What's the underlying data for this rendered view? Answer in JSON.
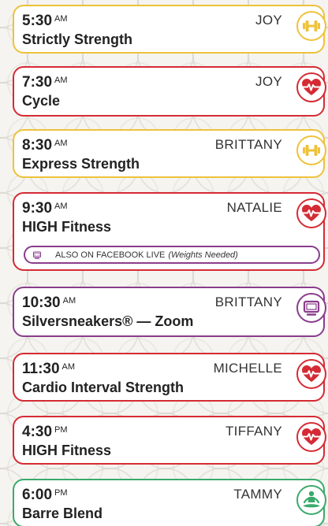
{
  "colors": {
    "strength": "#eec23a",
    "cardio": "#d52b34",
    "virtual": "#8a3d8c",
    "mind_body": "#3aaa6c"
  },
  "classes": [
    {
      "time": "5:30",
      "ampm": "AM",
      "instructor": "JOY",
      "title": "Strictly Strength",
      "icon": "dumbbell-icon",
      "category": "strength"
    },
    {
      "time": "7:30",
      "ampm": "AM",
      "instructor": "JOY",
      "title": "Cycle",
      "icon": "heartbeat-icon",
      "category": "cardio"
    },
    {
      "time": "8:30",
      "ampm": "AM",
      "instructor": "BRITTANY",
      "title": "Express Strength",
      "icon": "dumbbell-icon",
      "category": "strength"
    },
    {
      "time": "9:30",
      "ampm": "AM",
      "instructor": "NATALIE",
      "title": "HIGH Fitness",
      "icon": "heartbeat-icon",
      "category": "cardio",
      "sub_banner": {
        "label": "ALSO ON FACEBOOK LIVE",
        "note": "(Weights Needed)",
        "icon": "monitor-icon"
      }
    },
    {
      "time": "10:30",
      "ampm": "AM",
      "instructor": "BRITTANY",
      "title": "Silversneakers® — Zoom",
      "icon": "monitor-icon",
      "category": "virtual"
    },
    {
      "time": "11:30",
      "ampm": "AM",
      "instructor": "MICHELLE",
      "title": "Cardio Interval Strength",
      "icon": "heartbeat-icon",
      "category": "cardio"
    },
    {
      "time": "4:30",
      "ampm": "PM",
      "instructor": "TIFFANY",
      "title": "HIGH Fitness",
      "icon": "heartbeat-icon",
      "category": "cardio"
    },
    {
      "time": "6:00",
      "ampm": "PM",
      "instructor": "TAMMY",
      "title": "Barre Blend",
      "icon": "meditation-icon",
      "category": "mind_body"
    }
  ]
}
